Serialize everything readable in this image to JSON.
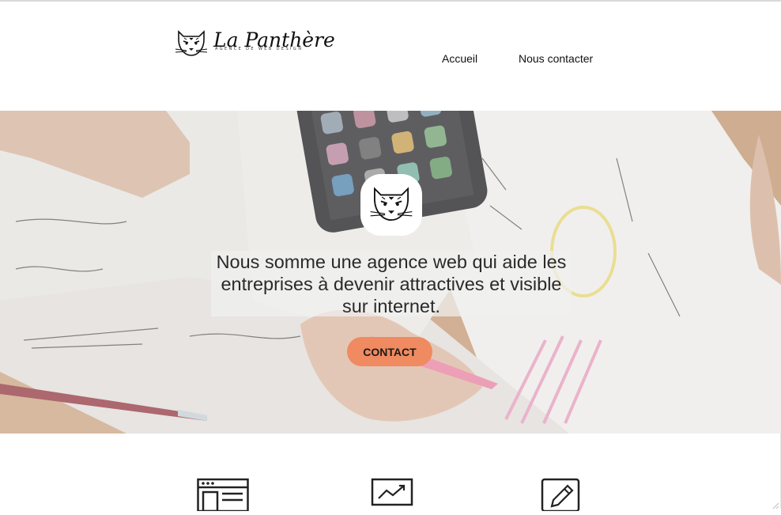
{
  "header": {
    "brand_name": "La Panthère",
    "brand_tagline": "AGENCE DE WEB DESIGN",
    "logo_icon": "panther-head-icon",
    "nav": [
      {
        "label": "Accueil"
      },
      {
        "label": "Nous contacter"
      }
    ]
  },
  "hero": {
    "badge_icon": "panther-head-icon",
    "headline": "Nous somme une agence web qui aide les entreprises à devenir attractives et visible sur internet.",
    "cta_label": "CONTACT",
    "cta_color": "#f08a60"
  },
  "services": {
    "icons": [
      "browser-window-icon",
      "trending-chart-icon",
      "pencil-edit-icon"
    ]
  }
}
